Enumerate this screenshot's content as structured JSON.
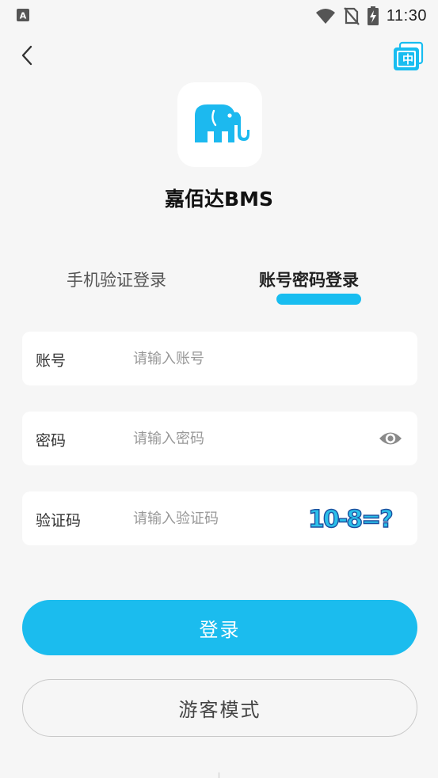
{
  "status_bar": {
    "time": "11:30",
    "icons": [
      "keyboard-a-icon",
      "wifi-icon",
      "no-sim-icon",
      "battery-charging-icon"
    ]
  },
  "nav": {
    "back_icon": "chevron-left-icon",
    "lang_label": "中"
  },
  "app": {
    "name": "嘉佰达BMS",
    "logo_icon": "elephant-icon",
    "brand_color": "#1bbcee"
  },
  "tabs": [
    {
      "label": "手机验证登录",
      "active": false
    },
    {
      "label": "账号密码登录",
      "active": true
    }
  ],
  "form": {
    "account": {
      "label": "账号",
      "placeholder": "请输入账号",
      "value": ""
    },
    "password": {
      "label": "密码",
      "placeholder": "请输入密码",
      "value": "",
      "toggle_icon": "eye-icon"
    },
    "captcha": {
      "label": "验证码",
      "placeholder": "请输入验证码",
      "value": "",
      "image_text": "10-8=?"
    }
  },
  "buttons": {
    "login": "登录",
    "guest": "游客模式"
  }
}
